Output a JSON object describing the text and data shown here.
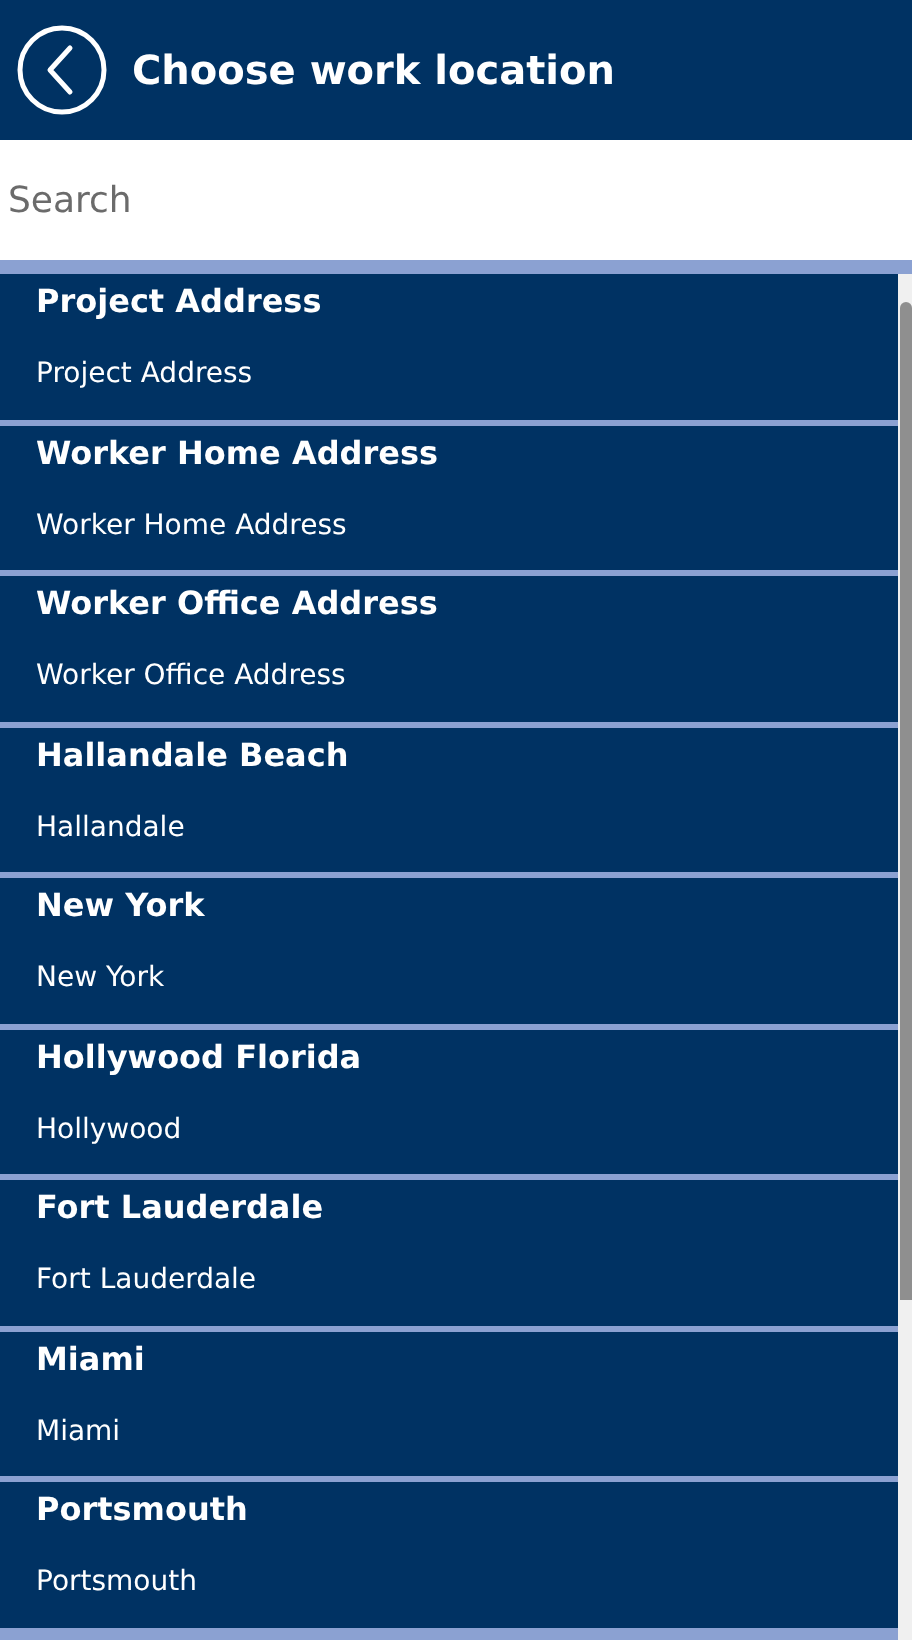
{
  "header": {
    "title": "Choose work location"
  },
  "search": {
    "placeholder": "Search"
  },
  "locations": [
    {
      "name": "Project Address",
      "detail": "Project Address"
    },
    {
      "name": "Worker Home Address",
      "detail": "Worker Home Address"
    },
    {
      "name": "Worker Office Address",
      "detail": "Worker Office Address"
    },
    {
      "name": "Hallandale Beach",
      "detail": "Hallandale"
    },
    {
      "name": "New York",
      "detail": "New York"
    },
    {
      "name": "Hollywood Florida",
      "detail": "Hollywood"
    },
    {
      "name": "Fort Lauderdale",
      "detail": "Fort Lauderdale"
    },
    {
      "name": "Miami",
      "detail": "Miami"
    },
    {
      "name": "Portsmouth",
      "detail": "Portsmouth"
    }
  ]
}
